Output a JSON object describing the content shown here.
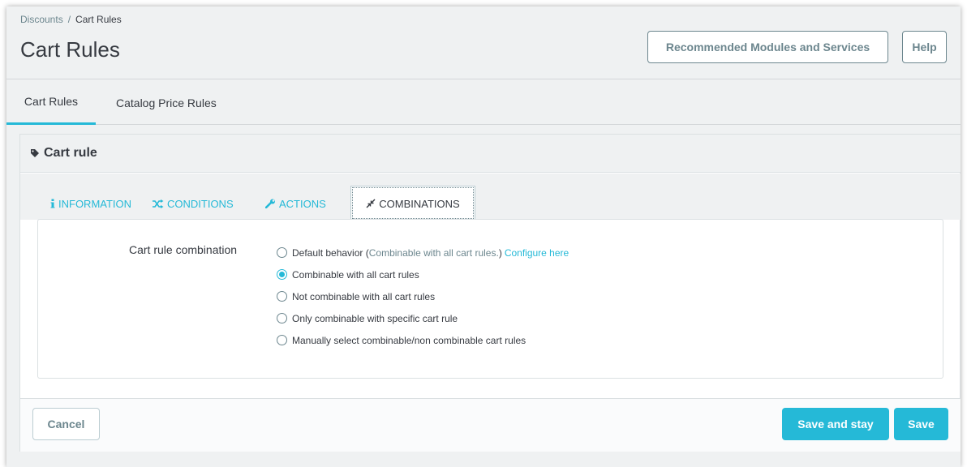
{
  "breadcrumb": {
    "parent": "Discounts",
    "separator": "/",
    "current": "Cart Rules"
  },
  "page_title": "Cart Rules",
  "toolbar": {
    "recommended_label": "Recommended Modules and Services",
    "help_label": "Help"
  },
  "top_tabs": [
    {
      "label": "Cart Rules",
      "active": true
    },
    {
      "label": "Catalog Price Rules",
      "active": false
    }
  ],
  "panel": {
    "heading": "Cart rule",
    "sub_tabs": [
      {
        "label": "INFORMATION",
        "icon": "info-icon"
      },
      {
        "label": "CONDITIONS",
        "icon": "shuffle-icon"
      },
      {
        "label": "ACTIONS",
        "icon": "wrench-icon"
      },
      {
        "label": "COMBINATIONS",
        "icon": "compress-icon",
        "active": true
      }
    ],
    "form": {
      "label": "Cart rule combination",
      "options": [
        {
          "label": "Default behavior",
          "note_open": "(",
          "note": "Combinable with all cart rules.",
          "note_close": ")",
          "link": "Configure here",
          "checked": false
        },
        {
          "label": "Combinable with all cart rules",
          "checked": true
        },
        {
          "label": "Not combinable with all cart rules",
          "checked": false
        },
        {
          "label": "Only combinable with specific cart rule",
          "checked": false
        },
        {
          "label": "Manually select combinable/non combinable cart rules",
          "checked": false
        }
      ]
    },
    "footer": {
      "cancel_label": "Cancel",
      "save_stay_label": "Save and stay",
      "save_label": "Save"
    }
  },
  "colors": {
    "accent": "#25b9d7",
    "text": "#363a41",
    "muted": "#6c868e",
    "background": "#eff1f2"
  }
}
